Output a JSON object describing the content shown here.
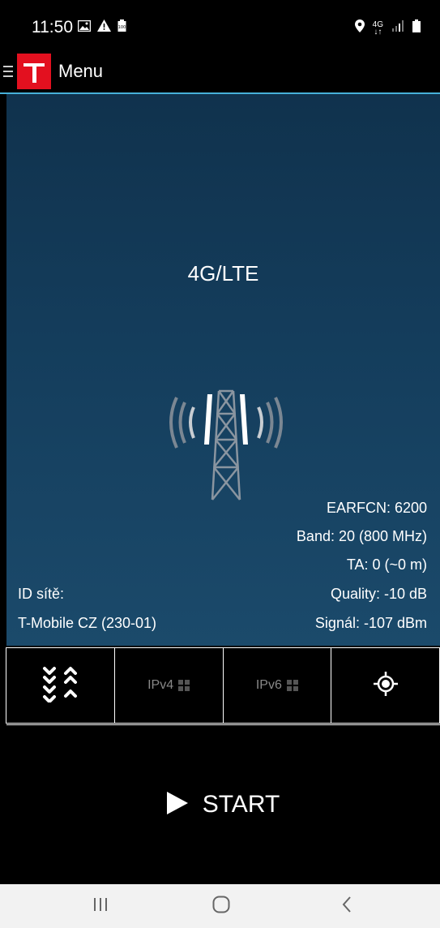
{
  "status_bar": {
    "time": "11:50",
    "network_label": "4G",
    "icons": [
      "gallery-icon",
      "warning-icon",
      "battery-saver-icon",
      "location-icon",
      "signal-icon",
      "battery-icon"
    ]
  },
  "app_bar": {
    "title": "Menu",
    "logo": "T",
    "accent_color": "#46b0d8",
    "brand_color": "#e3101f"
  },
  "network": {
    "type": "4G/LTE",
    "earfcn": "EARFCN: 6200",
    "band": "Band: 20 (800 MHz)",
    "ta": "TA: 0 (~0 m)",
    "quality": "Quality: -10 dB",
    "signal": "Signál: -107 dBm",
    "network_id_label": "ID sítě:",
    "operator": "T-Mobile CZ (230-01)"
  },
  "toolbar": {
    "ipv4_label": "IPv4",
    "ipv6_label": "IPv6",
    "icons": [
      "expand-collapse-icon",
      "ipv4-status-icon",
      "ipv6-status-icon",
      "location-target-icon"
    ]
  },
  "start": {
    "label": "START"
  },
  "nav_bar": {
    "icons": [
      "recent-apps-icon",
      "home-icon",
      "back-icon"
    ]
  }
}
